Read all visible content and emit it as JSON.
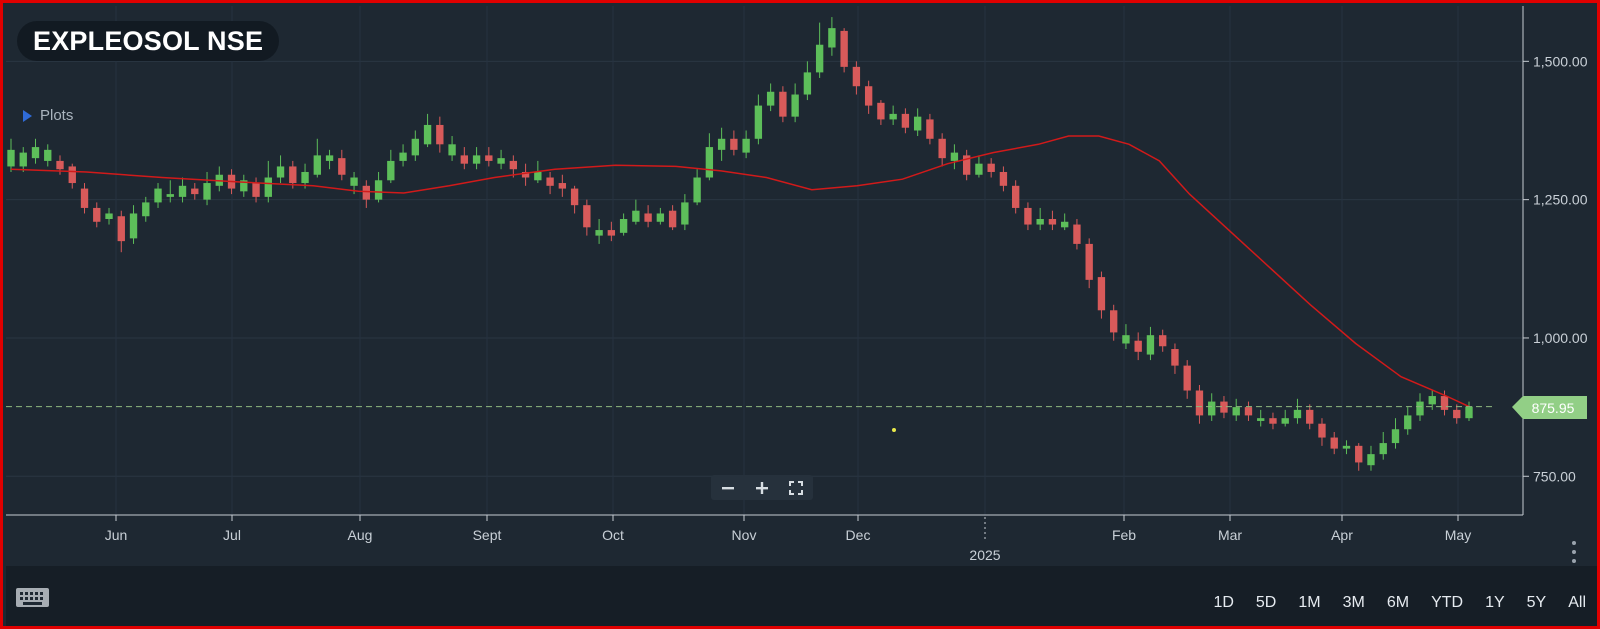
{
  "header": {
    "ticker": "EXPLEOSOL NSE",
    "plots_label": "Plots"
  },
  "price_badge": "875.95",
  "toolbar": {
    "zoom_out_icon": "minus-icon",
    "zoom_in_icon": "plus-icon",
    "fullscreen_icon": "expand-icon"
  },
  "range_buttons": [
    "1D",
    "5D",
    "1M",
    "3M",
    "6M",
    "YTD",
    "1Y",
    "5Y",
    "All"
  ],
  "colors": {
    "up": "#5dbe5a",
    "down": "#d85a5a",
    "ma": "#d11a1a",
    "badge": "#92cf86",
    "frame": "#e00000"
  },
  "chart_data": {
    "type": "candlestick",
    "y_ticks": [
      {
        "value": 1500,
        "label": "1,500.00"
      },
      {
        "value": 1250,
        "label": "1,250.00"
      },
      {
        "value": 1000,
        "label": "1,000.00"
      },
      {
        "value": 750,
        "label": "750.00"
      }
    ],
    "ylim": [
      680,
      1600
    ],
    "x_ticks": [
      "Jun",
      "Jul",
      "Aug",
      "Sept",
      "Oct",
      "Nov",
      "Dec",
      "2025",
      "Feb",
      "Mar",
      "Apr",
      "May"
    ],
    "year_label": "2025",
    "last_price": 875.95,
    "ma_series": [
      [
        0,
        1305
      ],
      [
        0.05,
        1300
      ],
      [
        0.1,
        1290
      ],
      [
        0.15,
        1282
      ],
      [
        0.2,
        1275
      ],
      [
        0.23,
        1265
      ],
      [
        0.26,
        1262
      ],
      [
        0.29,
        1275
      ],
      [
        0.32,
        1290
      ],
      [
        0.36,
        1305
      ],
      [
        0.4,
        1312
      ],
      [
        0.44,
        1310
      ],
      [
        0.47,
        1302
      ],
      [
        0.5,
        1290
      ],
      [
        0.53,
        1268
      ],
      [
        0.56,
        1275
      ],
      [
        0.59,
        1287
      ],
      [
        0.62,
        1315
      ],
      [
        0.65,
        1335
      ],
      [
        0.68,
        1350
      ],
      [
        0.7,
        1365
      ],
      [
        0.72,
        1365
      ],
      [
        0.74,
        1350
      ],
      [
        0.76,
        1320
      ],
      [
        0.78,
        1260
      ],
      [
        0.82,
        1160
      ],
      [
        0.86,
        1060
      ],
      [
        0.89,
        990
      ],
      [
        0.92,
        930
      ],
      [
        0.95,
        895
      ],
      [
        0.965,
        876
      ]
    ],
    "candles": [
      [
        1,
        1340,
        1310,
        1360,
        1300
      ],
      [
        1,
        1310,
        1335,
        1345,
        1300
      ],
      [
        1,
        1325,
        1345,
        1360,
        1315
      ],
      [
        1,
        1340,
        1320,
        1350,
        1310
      ],
      [
        0,
        1320,
        1305,
        1330,
        1295
      ],
      [
        0,
        1310,
        1280,
        1315,
        1270
      ],
      [
        0,
        1270,
        1235,
        1280,
        1225
      ],
      [
        0,
        1235,
        1210,
        1245,
        1200
      ],
      [
        1,
        1215,
        1225,
        1235,
        1205
      ],
      [
        0,
        1220,
        1175,
        1230,
        1155
      ],
      [
        1,
        1180,
        1225,
        1240,
        1170
      ],
      [
        1,
        1220,
        1245,
        1255,
        1210
      ],
      [
        1,
        1245,
        1270,
        1280,
        1235
      ],
      [
        1,
        1260,
        1255,
        1285,
        1245
      ],
      [
        1,
        1255,
        1275,
        1290,
        1245
      ],
      [
        0,
        1270,
        1260,
        1280,
        1250
      ],
      [
        1,
        1250,
        1280,
        1300,
        1240
      ],
      [
        1,
        1275,
        1295,
        1310,
        1265
      ],
      [
        0,
        1295,
        1270,
        1305,
        1260
      ],
      [
        1,
        1265,
        1285,
        1295,
        1255
      ],
      [
        0,
        1280,
        1255,
        1290,
        1245
      ],
      [
        1,
        1255,
        1290,
        1320,
        1245
      ],
      [
        1,
        1290,
        1310,
        1330,
        1280
      ],
      [
        0,
        1310,
        1280,
        1320,
        1270
      ],
      [
        1,
        1280,
        1300,
        1315,
        1270
      ],
      [
        1,
        1295,
        1330,
        1360,
        1290
      ],
      [
        1,
        1330,
        1320,
        1340,
        1305
      ],
      [
        0,
        1325,
        1295,
        1340,
        1285
      ],
      [
        1,
        1290,
        1275,
        1300,
        1260
      ],
      [
        0,
        1275,
        1250,
        1285,
        1235
      ],
      [
        1,
        1250,
        1285,
        1300,
        1245
      ],
      [
        1,
        1285,
        1320,
        1340,
        1280
      ],
      [
        1,
        1320,
        1335,
        1350,
        1310
      ],
      [
        1,
        1330,
        1360,
        1375,
        1320
      ],
      [
        1,
        1350,
        1385,
        1405,
        1345
      ],
      [
        0,
        1385,
        1350,
        1400,
        1335
      ],
      [
        1,
        1350,
        1330,
        1365,
        1320
      ],
      [
        0,
        1330,
        1315,
        1345,
        1305
      ],
      [
        1,
        1315,
        1330,
        1345,
        1305
      ],
      [
        0,
        1330,
        1320,
        1345,
        1310
      ],
      [
        1,
        1315,
        1325,
        1340,
        1305
      ],
      [
        0,
        1320,
        1305,
        1330,
        1290
      ],
      [
        0,
        1300,
        1290,
        1315,
        1275
      ],
      [
        1,
        1285,
        1300,
        1320,
        1280
      ],
      [
        0,
        1290,
        1275,
        1300,
        1260
      ],
      [
        0,
        1280,
        1270,
        1295,
        1255
      ],
      [
        0,
        1270,
        1240,
        1275,
        1225
      ],
      [
        0,
        1240,
        1200,
        1250,
        1185
      ],
      [
        1,
        1185,
        1195,
        1215,
        1170
      ],
      [
        0,
        1195,
        1185,
        1210,
        1175
      ],
      [
        1,
        1190,
        1215,
        1225,
        1185
      ],
      [
        1,
        1210,
        1230,
        1250,
        1205
      ],
      [
        0,
        1225,
        1210,
        1240,
        1200
      ],
      [
        1,
        1210,
        1225,
        1235,
        1205
      ],
      [
        0,
        1230,
        1200,
        1240,
        1195
      ],
      [
        1,
        1205,
        1245,
        1260,
        1195
      ],
      [
        1,
        1245,
        1290,
        1305,
        1240
      ],
      [
        1,
        1290,
        1345,
        1370,
        1285
      ],
      [
        1,
        1340,
        1360,
        1380,
        1320
      ],
      [
        0,
        1360,
        1340,
        1375,
        1330
      ],
      [
        1,
        1335,
        1360,
        1375,
        1325
      ],
      [
        1,
        1360,
        1420,
        1440,
        1350
      ],
      [
        1,
        1420,
        1445,
        1460,
        1410
      ],
      [
        0,
        1445,
        1400,
        1455,
        1390
      ],
      [
        1,
        1400,
        1440,
        1460,
        1390
      ],
      [
        1,
        1440,
        1480,
        1500,
        1430
      ],
      [
        1,
        1480,
        1530,
        1570,
        1470
      ],
      [
        1,
        1525,
        1560,
        1580,
        1510
      ],
      [
        0,
        1555,
        1490,
        1560,
        1480
      ],
      [
        0,
        1490,
        1455,
        1500,
        1440
      ],
      [
        0,
        1455,
        1420,
        1465,
        1405
      ],
      [
        0,
        1425,
        1395,
        1430,
        1385
      ],
      [
        1,
        1395,
        1405,
        1420,
        1385
      ],
      [
        0,
        1405,
        1380,
        1415,
        1370
      ],
      [
        1,
        1375,
        1400,
        1415,
        1365
      ],
      [
        0,
        1395,
        1360,
        1405,
        1350
      ],
      [
        0,
        1360,
        1325,
        1370,
        1310
      ],
      [
        1,
        1320,
        1335,
        1350,
        1305
      ],
      [
        0,
        1330,
        1295,
        1340,
        1285
      ],
      [
        1,
        1295,
        1315,
        1330,
        1290
      ],
      [
        0,
        1315,
        1300,
        1325,
        1290
      ],
      [
        0,
        1300,
        1275,
        1310,
        1265
      ],
      [
        0,
        1275,
        1235,
        1285,
        1225
      ],
      [
        0,
        1235,
        1205,
        1245,
        1195
      ],
      [
        1,
        1205,
        1215,
        1235,
        1195
      ],
      [
        0,
        1215,
        1205,
        1230,
        1195
      ],
      [
        1,
        1200,
        1210,
        1225,
        1195
      ],
      [
        0,
        1205,
        1170,
        1215,
        1160
      ],
      [
        0,
        1170,
        1105,
        1180,
        1090
      ],
      [
        0,
        1110,
        1050,
        1120,
        1035
      ],
      [
        0,
        1050,
        1010,
        1060,
        995
      ],
      [
        1,
        1005,
        990,
        1025,
        980
      ],
      [
        0,
        995,
        975,
        1010,
        960
      ],
      [
        1,
        970,
        1005,
        1020,
        960
      ],
      [
        0,
        1005,
        985,
        1015,
        975
      ],
      [
        0,
        980,
        950,
        990,
        935
      ],
      [
        0,
        950,
        905,
        960,
        890
      ],
      [
        0,
        905,
        860,
        915,
        845
      ],
      [
        1,
        860,
        885,
        900,
        850
      ],
      [
        0,
        885,
        865,
        895,
        855
      ],
      [
        1,
        860,
        875,
        890,
        850
      ],
      [
        0,
        875,
        860,
        885,
        850
      ],
      [
        1,
        855,
        850,
        870,
        840
      ],
      [
        0,
        855,
        845,
        865,
        835
      ],
      [
        1,
        845,
        855,
        870,
        840
      ],
      [
        1,
        855,
        870,
        890,
        845
      ],
      [
        0,
        870,
        845,
        880,
        835
      ],
      [
        0,
        845,
        820,
        855,
        805
      ],
      [
        0,
        820,
        800,
        830,
        790
      ],
      [
        1,
        800,
        805,
        815,
        790
      ],
      [
        0,
        805,
        775,
        810,
        760
      ],
      [
        1,
        770,
        790,
        805,
        760
      ],
      [
        1,
        790,
        810,
        830,
        780
      ],
      [
        1,
        810,
        835,
        855,
        800
      ],
      [
        1,
        835,
        860,
        875,
        825
      ],
      [
        1,
        860,
        885,
        900,
        850
      ],
      [
        1,
        880,
        895,
        905,
        870
      ],
      [
        0,
        895,
        870,
        905,
        860
      ],
      [
        0,
        870,
        855,
        880,
        845
      ],
      [
        1,
        855,
        876,
        885,
        850
      ]
    ]
  }
}
